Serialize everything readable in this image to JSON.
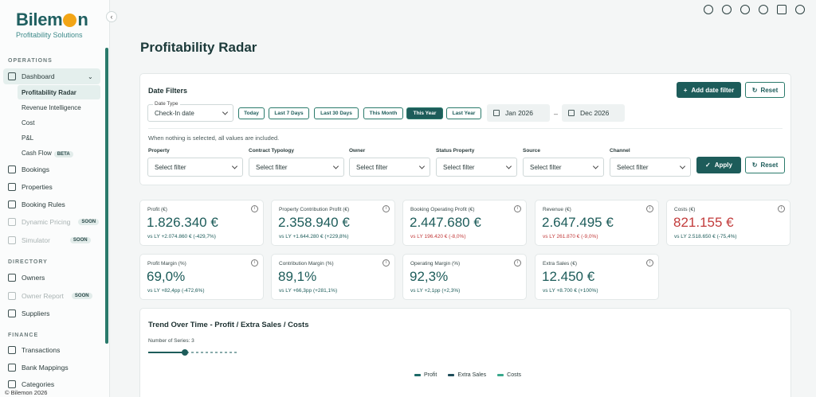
{
  "brand": {
    "name_start": "Bilem",
    "name_end": "n",
    "tagline": "Profitability Solutions"
  },
  "sidebar": {
    "sections": {
      "operations": "OPERATIONS",
      "directory": "DIRECTORY",
      "finance": "FINANCE"
    },
    "dashboard": "Dashboard",
    "dashboard_sub": [
      "Profitability Radar",
      "Revenue Intelligence",
      "Cost",
      "P&L",
      "Cash Flow"
    ],
    "cashflow_badge": "BETA",
    "operations_items": [
      "Bookings",
      "Properties",
      "Booking Rules",
      "Dynamic Pricing",
      "Simulator"
    ],
    "soon_badge": "SOON",
    "directory_items": [
      "Owners",
      "Owner Report",
      "Suppliers"
    ],
    "finance_items": [
      "Transactions",
      "Bank Mappings",
      "Categories"
    ],
    "footer": "© Bilemon 2026"
  },
  "page": {
    "title": "Profitability Radar"
  },
  "filters": {
    "title": "Date Filters",
    "add_date_filter": "Add date filter",
    "reset": "Reset",
    "date_type_label": "Date Type",
    "date_type_value": "Check-In date",
    "chips": [
      "Today",
      "Last 7 Days",
      "Last 30 Days",
      "This Month",
      "This Year",
      "Last Year"
    ],
    "active_chip": "This Year",
    "date_from": "Jan 2026",
    "date_to": "Dec 2026",
    "note": "When nothing is selected, all values are included.",
    "fields": [
      {
        "label": "Property",
        "value": "Select filter"
      },
      {
        "label": "Contract Typology",
        "value": "Select filter"
      },
      {
        "label": "Owner",
        "value": "Select filter"
      },
      {
        "label": "Status Property",
        "value": "Select filter"
      },
      {
        "label": "Source",
        "value": "Select filter"
      },
      {
        "label": "Channel",
        "value": "Select filter"
      }
    ],
    "apply": "Apply"
  },
  "kpis": [
    {
      "label": "Profit (€)",
      "value": "1.826.340 €",
      "sub": "vs LY +2.074.860 € (-429,7%)",
      "negative": false,
      "sub_negative": false
    },
    {
      "label": "Property Contribution Profit (€)",
      "value": "2.358.940 €",
      "sub": "vs LY +1.644.280 € (+229,8%)",
      "negative": false,
      "sub_negative": false
    },
    {
      "label": "Booking Operating Profit (€)",
      "value": "2.447.680 €",
      "sub": "vs LY 196.420 € (-8,0%)",
      "negative": false,
      "sub_negative": true
    },
    {
      "label": "Revenue (€)",
      "value": "2.647.495 €",
      "sub": "vs LY 261.870 € (-9,0%)",
      "negative": false,
      "sub_negative": true
    },
    {
      "label": "Costs (€)",
      "value": "821.155 €",
      "sub": "vs LY 2.518.650 € (-75,4%)",
      "negative": true,
      "sub_negative": false
    },
    {
      "label": "Profit Margin (%)",
      "value": "69,0%",
      "sub": "vs LY +82,4pp (-472,6%)",
      "negative": false,
      "sub_negative": false
    },
    {
      "label": "Contribution Margin (%)",
      "value": "89,1%",
      "sub": "vs LY +66,3pp (+281,1%)",
      "negative": false,
      "sub_negative": false
    },
    {
      "label": "Operating Margin (%)",
      "value": "92,3%",
      "sub": "vs LY +2,1pp (+2,3%)",
      "negative": false,
      "sub_negative": false
    },
    {
      "label": "Extra Sales (€)",
      "value": "12.450 €",
      "sub": "vs LY +8.700 € (+100%)",
      "negative": false,
      "sub_negative": false
    }
  ],
  "trend": {
    "title": "Trend Over Time - Profit / Extra Sales / Costs",
    "series_label": "Number of Series: 3",
    "series_count": 3,
    "legend": [
      {
        "name": "Profit",
        "color": "#1d6a68"
      },
      {
        "name": "Extra Sales",
        "color": "#1f4d5a"
      },
      {
        "name": "Costs",
        "color": "#3aa88c"
      }
    ]
  },
  "colors": {
    "primary": "#1d5c5a",
    "negative": "#c23b3b",
    "accent": "#f2a516"
  }
}
